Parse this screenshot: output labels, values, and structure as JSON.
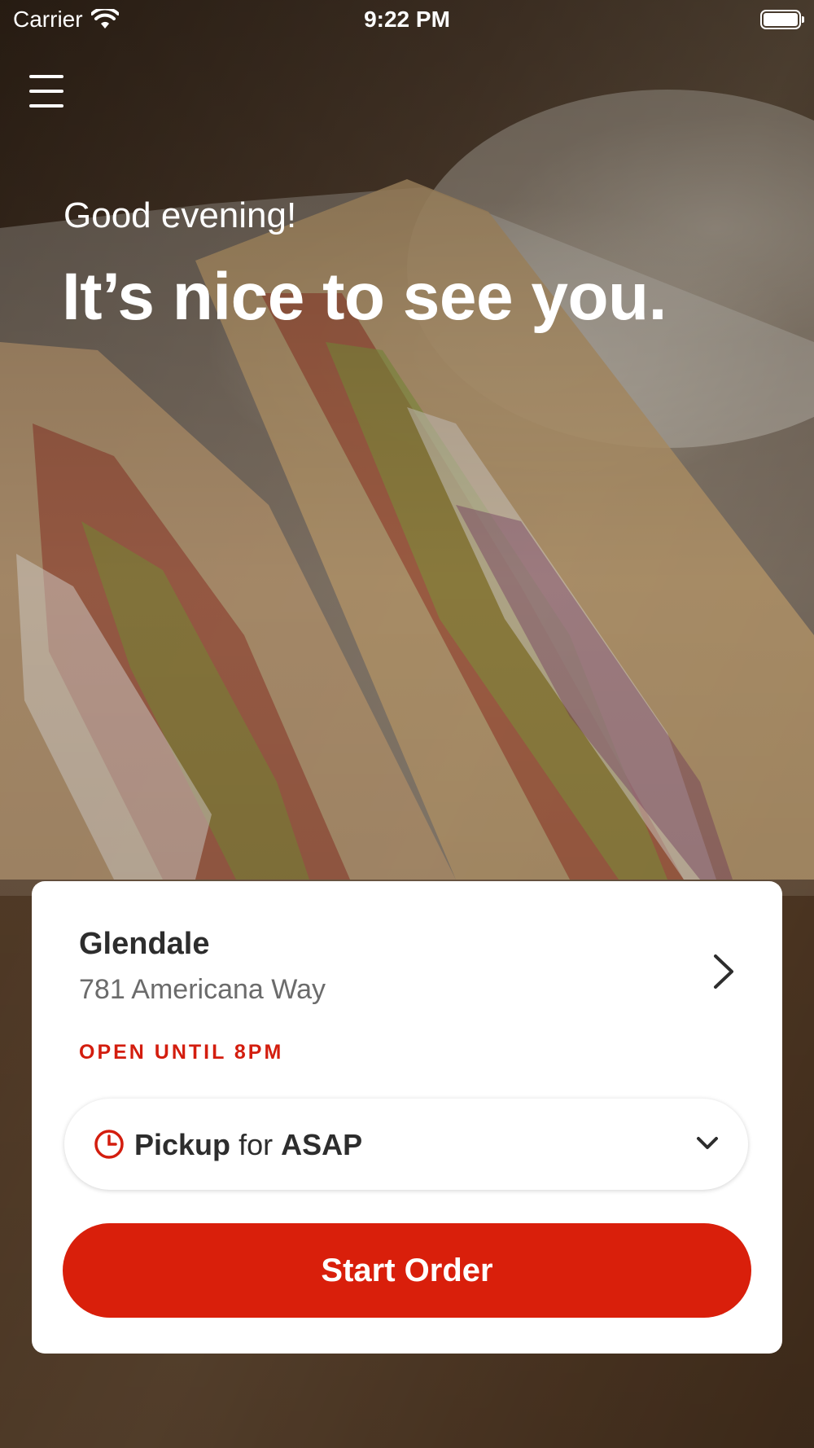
{
  "status_bar": {
    "carrier": "Carrier",
    "time": "9:22 PM",
    "wifi_icon": "wifi-icon",
    "battery_icon": "battery-icon"
  },
  "header": {
    "menu_icon": "hamburger-menu-icon"
  },
  "hero": {
    "greeting": "Good evening!",
    "headline": "It’s nice to see you."
  },
  "store": {
    "name": "Glendale",
    "address": "781 Americana Way",
    "status": "OPEN UNTIL 8PM",
    "chevron_icon": "chevron-right-icon"
  },
  "order_mode": {
    "mode": "Pickup",
    "connector": "for",
    "time": "ASAP",
    "clock_icon": "clock-icon",
    "dropdown_icon": "chevron-down-icon"
  },
  "cta": {
    "label": "Start Order"
  },
  "colors": {
    "accent": "#d91f0b",
    "status_text": "#d31d0e"
  }
}
